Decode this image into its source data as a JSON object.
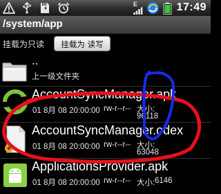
{
  "status_bar": {
    "time": "17:49",
    "signal_indicator": "E",
    "colors": {
      "background": "#2e2e2e",
      "icon": "#e8e8e8",
      "battery": "#3ec43e"
    },
    "icons": [
      "warning-icon",
      "usb-icon",
      "sd-card-icon",
      "alarm-clock-icon",
      "signal-strength-icon",
      "sync-icon",
      "battery-icon"
    ]
  },
  "path_header": {
    "path": "/system/app"
  },
  "mount": {
    "label": "挂载为只读",
    "button_label": "挂载为 读写"
  },
  "files": {
    "parent": {
      "name": "..",
      "description": "上一级文件夹"
    },
    "items": [
      {
        "name": "AccountSyncManager.apk",
        "date": "01 8月 08 20:00:00",
        "permissions": "rw-r--r--",
        "size_label": "大小:",
        "size": "96118"
      },
      {
        "name": "AccountSyncManager.odex",
        "date": "01 8月 08 20:00:00",
        "permissions": "rw-r--r--",
        "size_label": "大小:",
        "size": "63048"
      },
      {
        "name": "ApplicationsProvider.apk",
        "date": "01 8月 08 20:00:00",
        "permissions": "rw-r--r--",
        "size_label": "大小:",
        "size": "6146"
      }
    ]
  },
  "annotation_colors": {
    "red": "#e8101a",
    "blue": "#1a2ae8"
  }
}
